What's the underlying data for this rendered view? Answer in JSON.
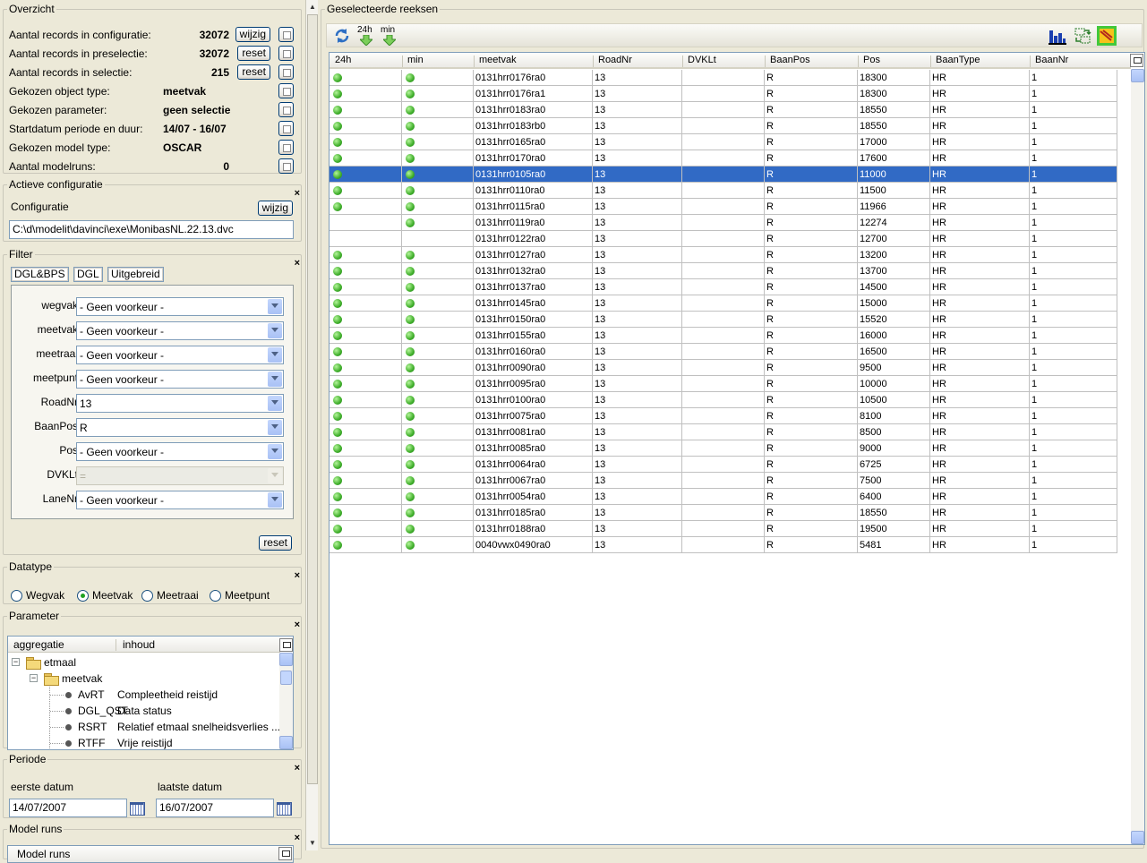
{
  "overzicht": {
    "title": "Overzicht",
    "rows": [
      {
        "label": "Aantal records in configuratie:",
        "value": "32072",
        "button": "wijzig"
      },
      {
        "label": "Aantal records in preselectie:",
        "value": "32072",
        "button": "reset"
      },
      {
        "label": "Aantal records in selectie:",
        "value": "215",
        "button": "reset"
      },
      {
        "label": "Gekozen object type:",
        "value": "meetvak",
        "button": ""
      },
      {
        "label": "Gekozen parameter:",
        "value": "geen selectie",
        "button": ""
      },
      {
        "label": "Startdatum periode en duur:",
        "value": "14/07 - 16/07",
        "button": ""
      },
      {
        "label": "Gekozen model type:",
        "value": "OSCAR",
        "button": ""
      },
      {
        "label": "Aantal modelruns:",
        "value": "0",
        "button": ""
      }
    ]
  },
  "actieve_configuratie": {
    "title": "Actieve configuratie",
    "label": "Configuratie",
    "button": "wijzig",
    "path": "C:\\d\\modelit\\davinci\\exe\\MonibasNL.22.13.dvc",
    "close": "×"
  },
  "filter": {
    "title": "Filter",
    "close": "×",
    "tabs": [
      "DGL&BPS",
      "DGL",
      "Uitgebreid"
    ],
    "rows": [
      {
        "label": "wegvak",
        "value": "- Geen voorkeur -",
        "disabled": false
      },
      {
        "label": "meetvak",
        "value": "- Geen voorkeur -",
        "disabled": false
      },
      {
        "label": "meetraai",
        "value": "- Geen voorkeur -",
        "disabled": false
      },
      {
        "label": "meetpunt",
        "value": "- Geen voorkeur -",
        "disabled": false
      },
      {
        "label": "RoadNr",
        "value": "13",
        "disabled": false
      },
      {
        "label": "BaanPos",
        "value": "R",
        "disabled": false
      },
      {
        "label": "Pos",
        "value": "- Geen voorkeur -",
        "disabled": false
      },
      {
        "label": "DVKLt",
        "value": "=",
        "disabled": true
      },
      {
        "label": "LaneNr",
        "value": "- Geen voorkeur -",
        "disabled": false
      }
    ],
    "reset": "reset"
  },
  "datatype": {
    "title": "Datatype",
    "close": "×",
    "options": [
      "Wegvak",
      "Meetvak",
      "Meetraai",
      "Meetpunt"
    ],
    "selected": "Meetvak"
  },
  "parameter": {
    "title": "Parameter",
    "close": "×",
    "columns": [
      "aggregatie",
      "inhoud"
    ],
    "tree": {
      "root": "etmaal",
      "child": "meetvak",
      "leaves": [
        {
          "code": "AvRT",
          "desc": "Compleetheid reistijd"
        },
        {
          "code": "DGL_QST",
          "desc": "Data status"
        },
        {
          "code": "RSRT",
          "desc": "Relatief etmaal snelheidsverlies",
          "more": "..."
        },
        {
          "code": "RTFF",
          "desc": "Vrije reistijd"
        }
      ]
    }
  },
  "periode": {
    "title": "Periode",
    "close": "×",
    "first_label": "eerste datum",
    "last_label": "laatste datum",
    "first_value": "14/07/2007",
    "last_value": "16/07/2007"
  },
  "model_runs": {
    "title": "Model runs",
    "close": "×",
    "column": "Model runs"
  },
  "reeksen": {
    "title": "Geselecteerde reeksen",
    "toolbar": {
      "label_24h": "24h",
      "label_min": "min"
    },
    "columns": [
      "24h",
      "min",
      "meetvak",
      "RoadNr",
      "DVKLt",
      "BaanPos",
      "Pos",
      "BaanType",
      "BaanNr"
    ],
    "selected_index": 6,
    "rows": [
      {
        "d24": true,
        "dmin": true,
        "meetvak": "0131hrr0176ra0",
        "road": "13",
        "dvklt": "",
        "baanpos": "R",
        "pos": "18300",
        "baantype": "HR",
        "baannr": "1"
      },
      {
        "d24": true,
        "dmin": true,
        "meetvak": "0131hrr0176ra1",
        "road": "13",
        "dvklt": "",
        "baanpos": "R",
        "pos": "18300",
        "baantype": "HR",
        "baannr": "1"
      },
      {
        "d24": true,
        "dmin": true,
        "meetvak": "0131hrr0183ra0",
        "road": "13",
        "dvklt": "",
        "baanpos": "R",
        "pos": "18550",
        "baantype": "HR",
        "baannr": "1"
      },
      {
        "d24": true,
        "dmin": true,
        "meetvak": "0131hrr0183rb0",
        "road": "13",
        "dvklt": "",
        "baanpos": "R",
        "pos": "18550",
        "baantype": "HR",
        "baannr": "1"
      },
      {
        "d24": true,
        "dmin": true,
        "meetvak": "0131hrr0165ra0",
        "road": "13",
        "dvklt": "",
        "baanpos": "R",
        "pos": "17000",
        "baantype": "HR",
        "baannr": "1"
      },
      {
        "d24": true,
        "dmin": true,
        "meetvak": "0131hrr0170ra0",
        "road": "13",
        "dvklt": "",
        "baanpos": "R",
        "pos": "17600",
        "baantype": "HR",
        "baannr": "1"
      },
      {
        "d24": true,
        "dmin": true,
        "meetvak": "0131hrr0105ra0",
        "road": "13",
        "dvklt": "",
        "baanpos": "R",
        "pos": "11000",
        "baantype": "HR",
        "baannr": "1"
      },
      {
        "d24": true,
        "dmin": true,
        "meetvak": "0131hrr0110ra0",
        "road": "13",
        "dvklt": "",
        "baanpos": "R",
        "pos": "11500",
        "baantype": "HR",
        "baannr": "1"
      },
      {
        "d24": true,
        "dmin": true,
        "meetvak": "0131hrr0115ra0",
        "road": "13",
        "dvklt": "",
        "baanpos": "R",
        "pos": "11966",
        "baantype": "HR",
        "baannr": "1"
      },
      {
        "d24": false,
        "dmin": true,
        "meetvak": "0131hrr0119ra0",
        "road": "13",
        "dvklt": "",
        "baanpos": "R",
        "pos": "12274",
        "baantype": "HR",
        "baannr": "1"
      },
      {
        "d24": false,
        "dmin": false,
        "meetvak": "0131hrr0122ra0",
        "road": "13",
        "dvklt": "",
        "baanpos": "R",
        "pos": "12700",
        "baantype": "HR",
        "baannr": "1"
      },
      {
        "d24": true,
        "dmin": true,
        "meetvak": "0131hrr0127ra0",
        "road": "13",
        "dvklt": "",
        "baanpos": "R",
        "pos": "13200",
        "baantype": "HR",
        "baannr": "1"
      },
      {
        "d24": true,
        "dmin": true,
        "meetvak": "0131hrr0132ra0",
        "road": "13",
        "dvklt": "",
        "baanpos": "R",
        "pos": "13700",
        "baantype": "HR",
        "baannr": "1"
      },
      {
        "d24": true,
        "dmin": true,
        "meetvak": "0131hrr0137ra0",
        "road": "13",
        "dvklt": "",
        "baanpos": "R",
        "pos": "14500",
        "baantype": "HR",
        "baannr": "1"
      },
      {
        "d24": true,
        "dmin": true,
        "meetvak": "0131hrr0145ra0",
        "road": "13",
        "dvklt": "",
        "baanpos": "R",
        "pos": "15000",
        "baantype": "HR",
        "baannr": "1"
      },
      {
        "d24": true,
        "dmin": true,
        "meetvak": "0131hrr0150ra0",
        "road": "13",
        "dvklt": "",
        "baanpos": "R",
        "pos": "15520",
        "baantype": "HR",
        "baannr": "1"
      },
      {
        "d24": true,
        "dmin": true,
        "meetvak": "0131hrr0155ra0",
        "road": "13",
        "dvklt": "",
        "baanpos": "R",
        "pos": "16000",
        "baantype": "HR",
        "baannr": "1"
      },
      {
        "d24": true,
        "dmin": true,
        "meetvak": "0131hrr0160ra0",
        "road": "13",
        "dvklt": "",
        "baanpos": "R",
        "pos": "16500",
        "baantype": "HR",
        "baannr": "1"
      },
      {
        "d24": true,
        "dmin": true,
        "meetvak": "0131hrr0090ra0",
        "road": "13",
        "dvklt": "",
        "baanpos": "R",
        "pos": "9500",
        "baantype": "HR",
        "baannr": "1"
      },
      {
        "d24": true,
        "dmin": true,
        "meetvak": "0131hrr0095ra0",
        "road": "13",
        "dvklt": "",
        "baanpos": "R",
        "pos": "10000",
        "baantype": "HR",
        "baannr": "1"
      },
      {
        "d24": true,
        "dmin": true,
        "meetvak": "0131hrr0100ra0",
        "road": "13",
        "dvklt": "",
        "baanpos": "R",
        "pos": "10500",
        "baantype": "HR",
        "baannr": "1"
      },
      {
        "d24": true,
        "dmin": true,
        "meetvak": "0131hrr0075ra0",
        "road": "13",
        "dvklt": "",
        "baanpos": "R",
        "pos": "8100",
        "baantype": "HR",
        "baannr": "1"
      },
      {
        "d24": true,
        "dmin": true,
        "meetvak": "0131hrr0081ra0",
        "road": "13",
        "dvklt": "",
        "baanpos": "R",
        "pos": "8500",
        "baantype": "HR",
        "baannr": "1"
      },
      {
        "d24": true,
        "dmin": true,
        "meetvak": "0131hrr0085ra0",
        "road": "13",
        "dvklt": "",
        "baanpos": "R",
        "pos": "9000",
        "baantype": "HR",
        "baannr": "1"
      },
      {
        "d24": true,
        "dmin": true,
        "meetvak": "0131hrr0064ra0",
        "road": "13",
        "dvklt": "",
        "baanpos": "R",
        "pos": "6725",
        "baantype": "HR",
        "baannr": "1"
      },
      {
        "d24": true,
        "dmin": true,
        "meetvak": "0131hrr0067ra0",
        "road": "13",
        "dvklt": "",
        "baanpos": "R",
        "pos": "7500",
        "baantype": "HR",
        "baannr": "1"
      },
      {
        "d24": true,
        "dmin": true,
        "meetvak": "0131hrr0054ra0",
        "road": "13",
        "dvklt": "",
        "baanpos": "R",
        "pos": "6400",
        "baantype": "HR",
        "baannr": "1"
      },
      {
        "d24": true,
        "dmin": true,
        "meetvak": "0131hrr0185ra0",
        "road": "13",
        "dvklt": "",
        "baanpos": "R",
        "pos": "18550",
        "baantype": "HR",
        "baannr": "1"
      },
      {
        "d24": true,
        "dmin": true,
        "meetvak": "0131hrr0188ra0",
        "road": "13",
        "dvklt": "",
        "baanpos": "R",
        "pos": "19500",
        "baantype": "HR",
        "baannr": "1"
      },
      {
        "d24": true,
        "dmin": true,
        "meetvak": "0040vwx0490ra0",
        "road": "13",
        "dvklt": "",
        "baanpos": "R",
        "pos": "5481",
        "baantype": "HR",
        "baannr": "1"
      }
    ]
  },
  "icons": {
    "refresh": "refresh-icon",
    "download_24h": "download-24h-icon",
    "download_min": "download-min-icon",
    "chart": "bar-chart-icon",
    "transfer": "transfer-icon",
    "export": "export-icon"
  },
  "colors": {
    "selection": "#316ac5",
    "status_green": "#3fae2a",
    "xp_border": "#003c74"
  }
}
